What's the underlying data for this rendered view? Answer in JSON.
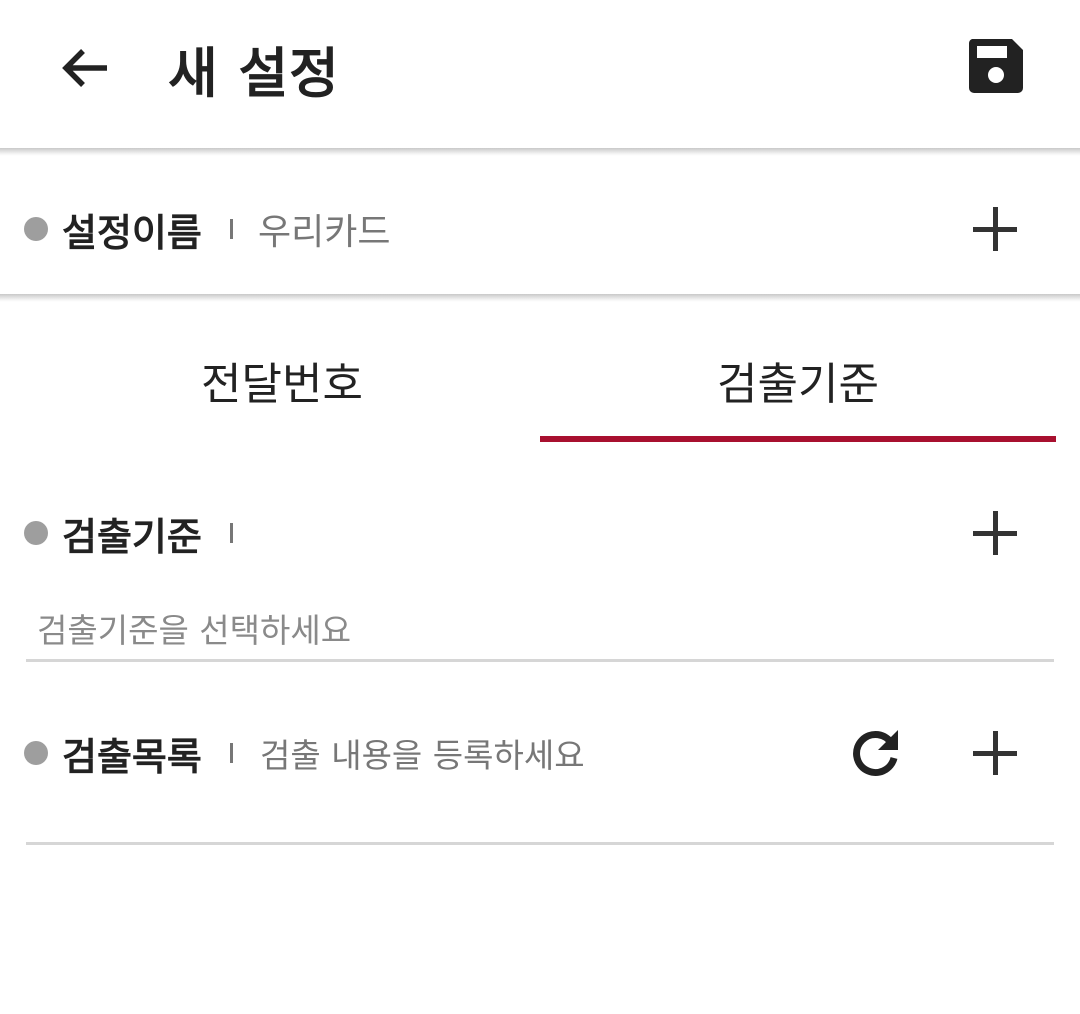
{
  "header": {
    "title": "새 설정",
    "back_icon": "arrow-left-icon",
    "save_icon": "floppy-disk-icon"
  },
  "setting_name": {
    "label": "설정이름",
    "value": "우리카드",
    "add_icon": "plus-icon"
  },
  "tabs": [
    {
      "label": "전달번호",
      "selected": false
    },
    {
      "label": "검출기준",
      "selected": true
    }
  ],
  "criteria": {
    "label": "검출기준",
    "placeholder": "검출기준을 선택하세요",
    "add_icon": "plus-icon"
  },
  "detection_list": {
    "label": "검출목록",
    "hint": "검출 내용을 등록하세요",
    "refresh_icon": "refresh-icon",
    "add_icon": "plus-icon"
  },
  "colors": {
    "accent": "#a8102f",
    "bullet": "#9e9e9e",
    "text": "#222222",
    "muted": "#777777"
  }
}
